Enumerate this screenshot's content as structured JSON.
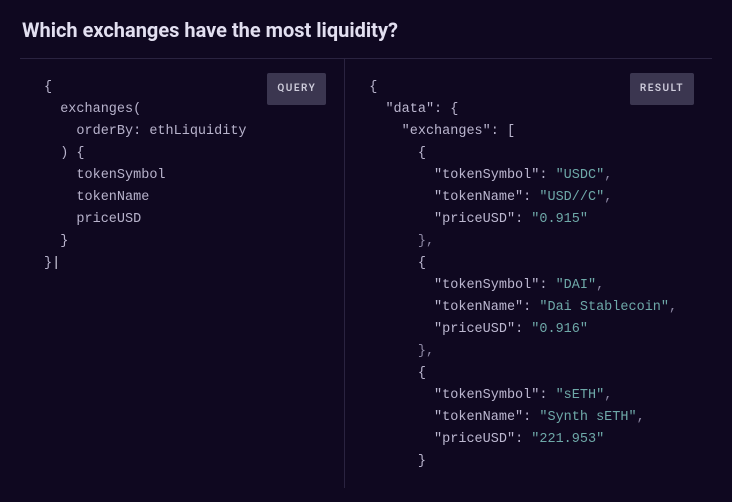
{
  "title": "Which exchanges have the most liquidity?",
  "left_badge": "QUERY",
  "right_badge": "RESULT",
  "q": {
    "o1": "{",
    "fn": "exchanges(",
    "arg": "orderBy: ethLiquidity",
    "c1": ") {",
    "f1": "tokenSymbol",
    "f2": "tokenName",
    "f3": "priceUSD",
    "c2": "}",
    "c3": "}",
    "cur": "|"
  },
  "r": {
    "o1": "{",
    "k_data": "\"data\"",
    "k_ex": "\"exchanges\"",
    "k_ts": "\"tokenSymbol\"",
    "k_tn": "\"tokenName\"",
    "k_pu": "\"priceUSD\"",
    "v_ts1": "\"USDC\"",
    "v_tn1": "\"USD//C\"",
    "v_pu1": "\"0.915\"",
    "v_ts2": "\"DAI\"",
    "v_tn2": "\"Dai Stablecoin\"",
    "v_pu2": "\"0.916\"",
    "v_ts3": "\"sETH\"",
    "v_tn3": "\"Synth sETH\"",
    "v_pu3": "\"221.953\"",
    "ob": "{",
    "cb": "}",
    "osb": "[",
    "col": ": ",
    "com": ",",
    "cbc": "},"
  }
}
